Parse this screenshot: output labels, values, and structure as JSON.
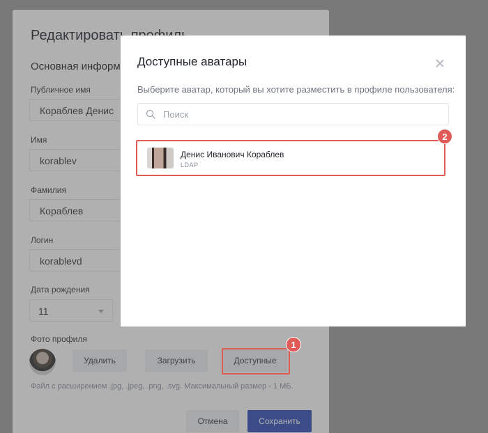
{
  "page": {
    "title": "Редактировать профиль",
    "section_title": "Основная информация",
    "fields": {
      "public_name_label": "Публичное имя",
      "public_name_value": "Кораблев Денис",
      "first_name_label": "Имя",
      "first_name_value": "korablev",
      "last_name_label": "Фамилия",
      "last_name_value": "Кораблев",
      "login_label": "Логин",
      "login_value": "korablevd",
      "birth_date_label": "Дата рождения",
      "birth_day_value": "11"
    },
    "photo": {
      "label": "Фото профиля",
      "delete_label": "Удалить",
      "upload_label": "Загрузить",
      "available_label": "Доступные",
      "hint": "Файл с расширением .jpg, .jpeg, .png, .svg. Максимальный размер - 1 МБ."
    },
    "footer": {
      "cancel_label": "Отмена",
      "save_label": "Сохранить"
    }
  },
  "modal": {
    "title": "Доступные аватары",
    "description": "Выберите аватар, который вы хотите разместить в профиле пользователя:",
    "search_placeholder": "Поиск",
    "options": [
      {
        "name": "Денис Иванович Кораблев",
        "source": "LDAP"
      }
    ]
  },
  "annotations": {
    "badge_1": "1",
    "badge_2": "2",
    "color": "#e05a58"
  },
  "colors": {
    "primary": "#2d4ab8",
    "overlay": "rgba(80,80,80,0.45)"
  }
}
